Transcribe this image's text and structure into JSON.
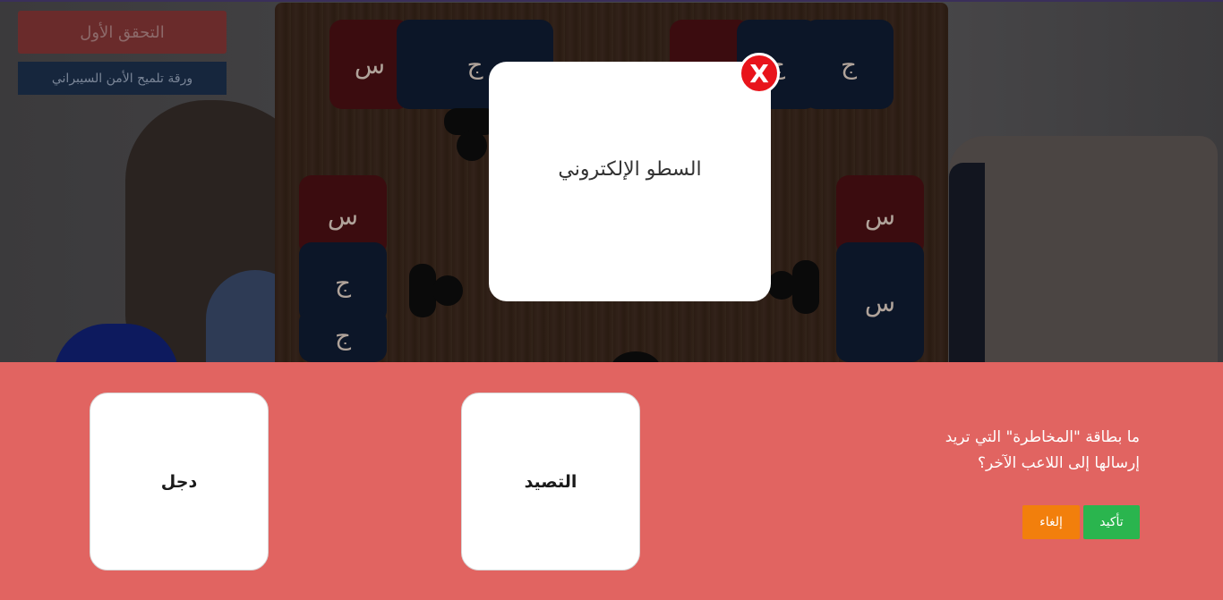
{
  "top_left": {
    "first_check_label": "التحقق الأول",
    "hint_sheet_label": "ورقة تلميح الأمن السيبراني"
  },
  "board": {
    "tiles": {
      "top_red_1": "س",
      "top_navy_1": "ج",
      "top_red_2": "",
      "top_navy_2": "ج",
      "top_navy_3": "ج",
      "left_red": "س",
      "left_navy_1": "ج",
      "left_navy_2": "ج",
      "right_red": "س",
      "right_navy": "س"
    }
  },
  "modal": {
    "card_text": "السطو الإلكتروني",
    "close_label": "X"
  },
  "bottom": {
    "question_line1": "ما بطاقة \"المخاطرة\" التي تريد",
    "question_line2": "إرسالها إلى اللاعب الآخر؟",
    "cards": [
      "دجل",
      "التصيد"
    ],
    "confirm_label": "تأكيد",
    "cancel_label": "إلغاء"
  },
  "colors": {
    "panel": "#e16461",
    "confirm": "#2ab54e",
    "cancel": "#f27f0c",
    "close": "#e8141b"
  }
}
